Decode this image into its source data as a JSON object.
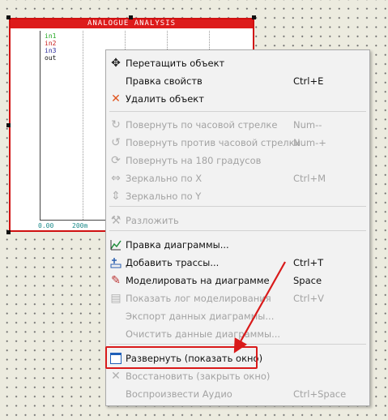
{
  "graph": {
    "title": "ANALOGUE ANALYSIS",
    "traces": [
      {
        "name": "in1",
        "color": "#22a822"
      },
      {
        "name": "in2",
        "color": "#c81e1e"
      },
      {
        "name": "in3",
        "color": "#2a2a9a"
      },
      {
        "name": "out",
        "color": "#111111"
      }
    ],
    "x_ticks": [
      "0.00",
      "200m"
    ]
  },
  "menu": {
    "items": [
      {
        "label": "Перетащить объект",
        "shortcut": "",
        "icon": "move-icon",
        "disabled": false
      },
      {
        "label": "Правка свойств",
        "shortcut": "Ctrl+E",
        "icon": "",
        "disabled": false
      },
      {
        "label": "Удалить объект",
        "shortcut": "",
        "icon": "delete-icon",
        "disabled": false
      },
      {
        "label": "Повернуть по часовой стрелке",
        "shortcut": "Num--",
        "icon": "rotate-cw-icon",
        "disabled": true
      },
      {
        "label": "Повернуть против часовой стрелки",
        "shortcut": "Num-+",
        "icon": "rotate-ccw-icon",
        "disabled": true
      },
      {
        "label": "Повернуть на 180 градусов",
        "shortcut": "",
        "icon": "rotate-180-icon",
        "disabled": true
      },
      {
        "label": "Зеркально по X",
        "shortcut": "Ctrl+M",
        "icon": "mirror-x-icon",
        "disabled": true
      },
      {
        "label": "Зеркально по Y",
        "shortcut": "",
        "icon": "mirror-y-icon",
        "disabled": true
      },
      {
        "label": "Разложить",
        "shortcut": "",
        "icon": "decompose-icon",
        "disabled": true
      },
      {
        "label": "Правка диаграммы...",
        "shortcut": "",
        "icon": "edit-graph-icon",
        "disabled": false
      },
      {
        "label": "Добавить трассы...",
        "shortcut": "Ctrl+T",
        "icon": "add-traces-icon",
        "disabled": false
      },
      {
        "label": "Моделировать на диаграмме",
        "shortcut": "Space",
        "icon": "simulate-icon",
        "disabled": false
      },
      {
        "label": "Показать лог моделирования",
        "shortcut": "Ctrl+V",
        "icon": "sim-log-icon",
        "disabled": true
      },
      {
        "label": "Экспорт данных диаграммы...",
        "shortcut": "",
        "icon": "",
        "disabled": true
      },
      {
        "label": "Очистить данные диаграммы...",
        "shortcut": "",
        "icon": "",
        "disabled": true
      },
      {
        "label": "Развернуть (показать окно)",
        "shortcut": "",
        "icon": "maximize-window-icon",
        "disabled": false
      },
      {
        "label": "Восстановить (закрыть окно)",
        "shortcut": "",
        "icon": "restore-window-icon",
        "disabled": true
      },
      {
        "label": "Воспроизвести Аудио",
        "shortcut": "Ctrl+Space",
        "icon": "",
        "disabled": true
      }
    ]
  },
  "colors": {
    "highlight": "#d91a1a",
    "graph_border": "#d01010",
    "disabled_text": "#a3a3a3"
  }
}
